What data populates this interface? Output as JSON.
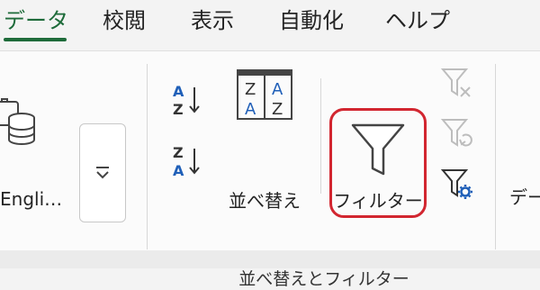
{
  "tabs": [
    {
      "label": "データ",
      "active": true
    },
    {
      "label": "校閲",
      "active": false
    },
    {
      "label": "表示",
      "active": false
    },
    {
      "label": "自動化",
      "active": false
    },
    {
      "label": "ヘルプ",
      "active": false
    }
  ],
  "ribbon": {
    "language_label": "Engli…",
    "sort_label": "並べ替え",
    "filter_label": "フィルター",
    "group_label": "並べ替えとフィルター",
    "next_group_partial": "デー"
  },
  "colors": {
    "accent": "#1e6b3a",
    "highlight": "#d22630",
    "sort_blue": "#1f5fb8"
  },
  "icons": {
    "sort_az": "sort-ascending-icon",
    "sort_za": "sort-descending-icon",
    "filter": "funnel-icon",
    "clear": "clear-filter-icon",
    "reapply": "reapply-filter-icon",
    "advanced": "advanced-filter-icon"
  }
}
